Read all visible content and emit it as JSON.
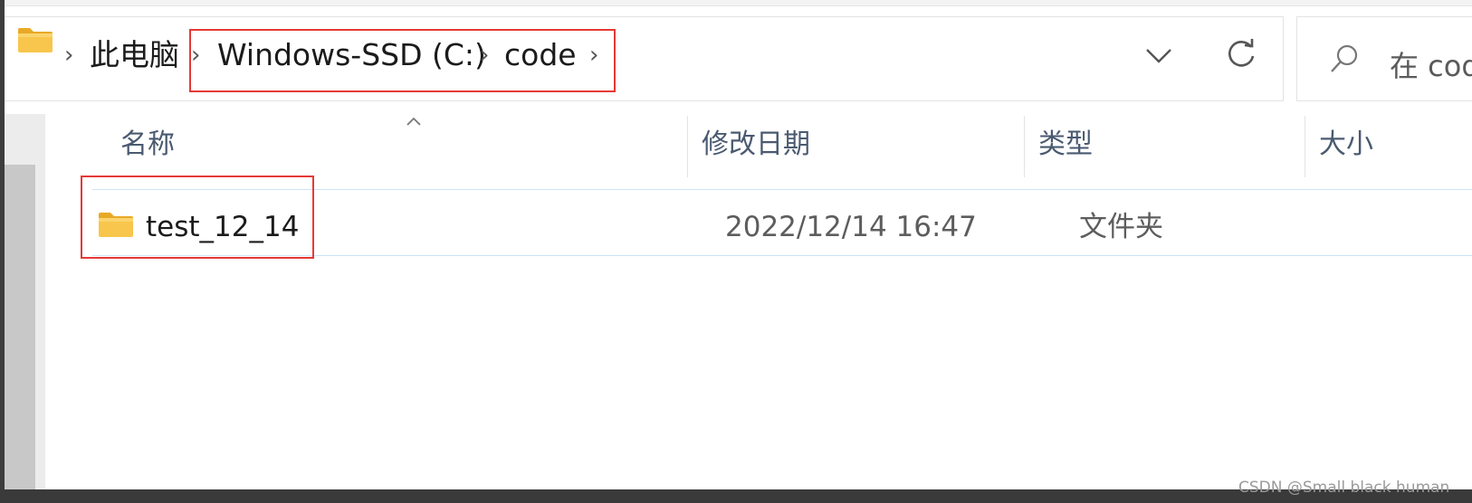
{
  "breadcrumb": {
    "items": [
      "此电脑",
      "Windows-SSD (C:)",
      "code"
    ]
  },
  "search": {
    "placeholder": "在 cod"
  },
  "columns": {
    "name": "名称",
    "date_modified": "修改日期",
    "type": "类型",
    "size": "大小"
  },
  "rows": [
    {
      "name": "test_12_14",
      "date_modified": "2022/12/14 16:47",
      "type": "文件夹",
      "size": ""
    }
  ],
  "icons": {
    "folder": "folder-icon",
    "chevron": "chevron-right-icon",
    "dropdown": "chevron-down-icon",
    "refresh": "refresh-icon",
    "search": "search-icon",
    "sort": "sort-ascending-icon"
  },
  "colors": {
    "highlight_box": "#e53935",
    "folder_body": "#f8c64c",
    "folder_tab": "#e9a926"
  },
  "watermark": "CSDN @Small black human"
}
